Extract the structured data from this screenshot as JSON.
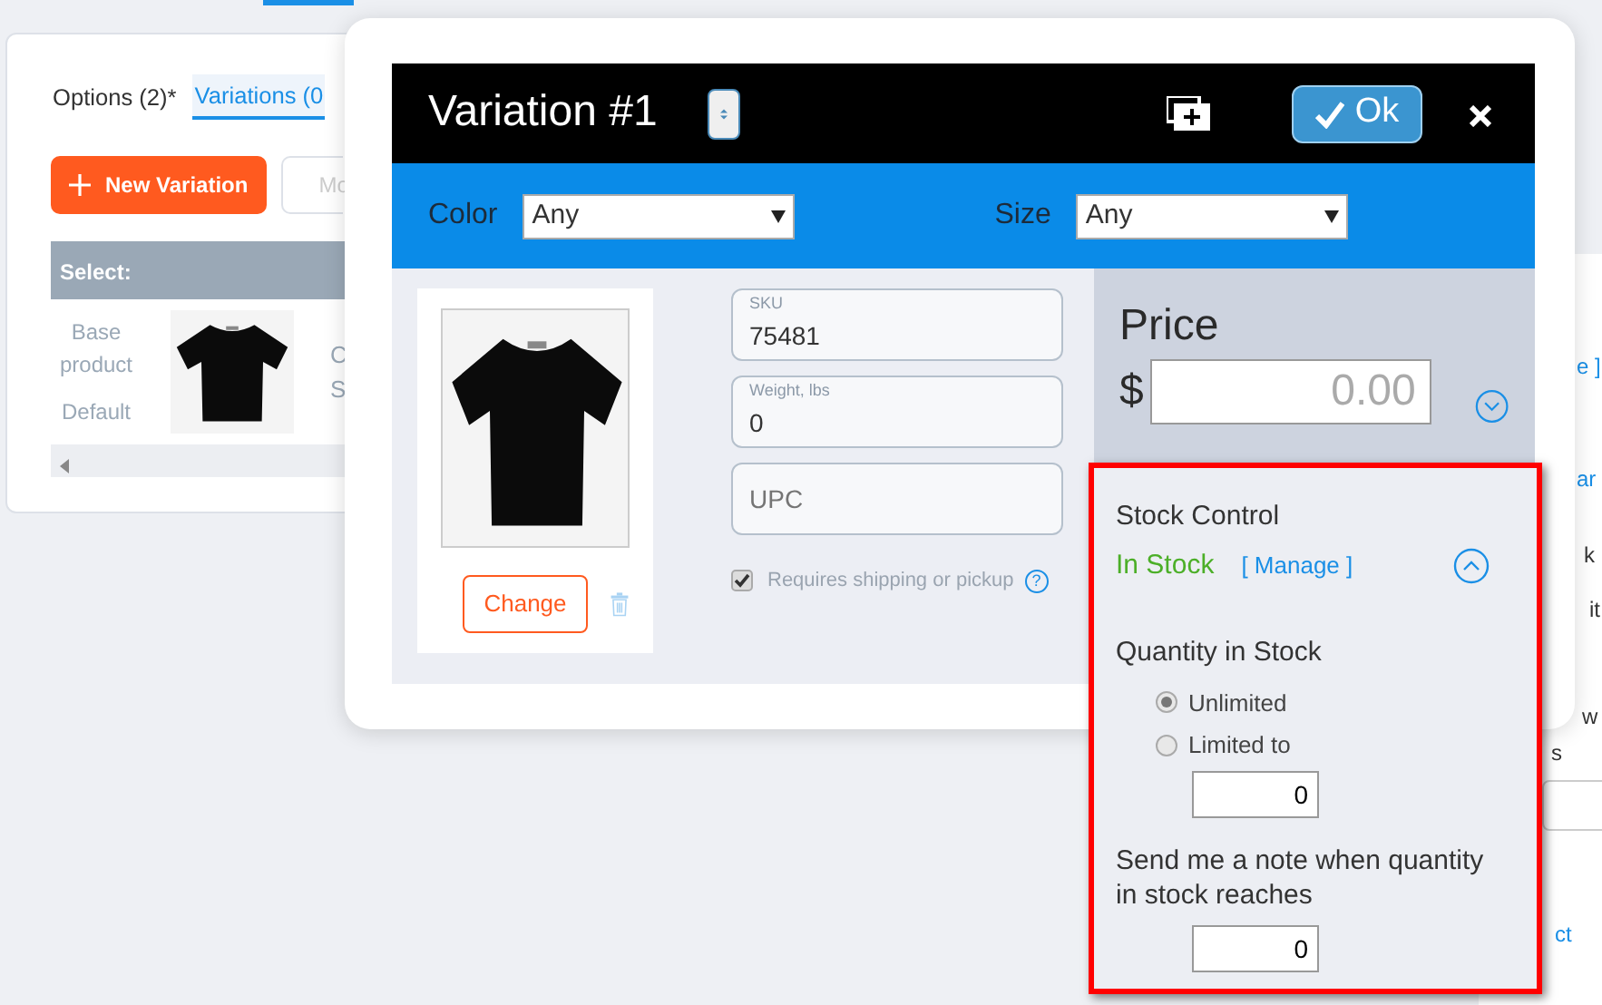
{
  "background": {
    "tabs": [
      {
        "label": "Options (2)*",
        "selected": false
      },
      {
        "label": "Variations (0",
        "selected": true
      }
    ],
    "new_button": "New Variation",
    "more_button": "Mo",
    "table": {
      "header": "Select:",
      "rows": [
        {
          "label": "Base product",
          "sub_label": "Default",
          "column_3": "C",
          "column_3_line_2": "S"
        }
      ]
    },
    "fragments": [
      {
        "text": "e ]",
        "kind": "link"
      },
      {
        "text": "ar",
        "kind": "link"
      },
      {
        "text": "k",
        "kind": "text"
      },
      {
        "text": "it",
        "kind": "text"
      },
      {
        "text": "w",
        "kind": "text"
      },
      {
        "text": "s",
        "kind": "text"
      },
      {
        "text": "ct",
        "kind": "link"
      }
    ]
  },
  "modal": {
    "title": "Variation #1",
    "ok_button": "Ok",
    "filters": [
      {
        "label": "Color",
        "value": "Any"
      },
      {
        "label": "Size",
        "value": "Any"
      }
    ],
    "fields": [
      {
        "label": "SKU",
        "value": "75481"
      },
      {
        "label": "Weight, lbs",
        "value": "0"
      },
      {
        "placeholder": "UPC"
      }
    ],
    "change_button": "Change",
    "requires_shipping": {
      "label": "Requires shipping or pickup",
      "checked": true,
      "help": "?"
    },
    "price": {
      "title": "Price",
      "currency": "$",
      "placeholder": "0.00"
    },
    "stock": {
      "title": "Stock Control",
      "status": "In Stock",
      "manage": "[ Manage ]",
      "quantity_label": "Quantity in Stock",
      "options": [
        {
          "label": "Unlimited",
          "selected": true
        },
        {
          "label": "Limited to",
          "selected": false
        }
      ],
      "limit_value": "0",
      "note_label": "Send me a note when quantity in stock reaches",
      "note_value": "0"
    }
  }
}
